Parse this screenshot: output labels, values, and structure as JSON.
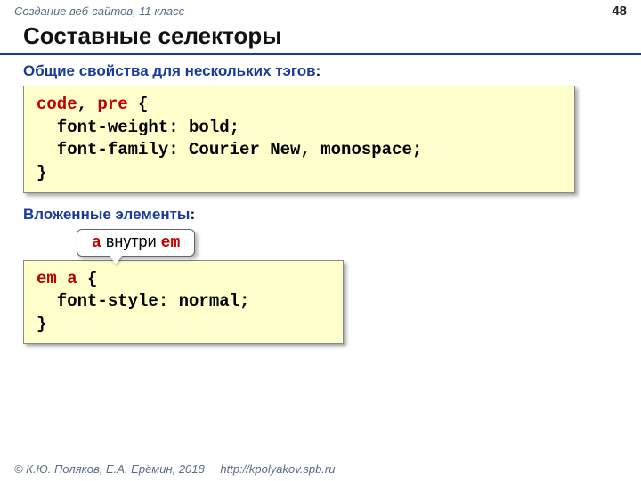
{
  "header": {
    "course": "Создание веб-сайтов, 11 класс",
    "page_number": "48"
  },
  "title": "Составные селекторы",
  "section1": {
    "heading": "Общие свойства для нескольких тэгов",
    "colon": ":",
    "code": {
      "sel1": "code",
      "comma": ", ",
      "sel2": "pre",
      "open": " {",
      "line1": "  font-weight: bold;",
      "line2": "  font-family: Courier New, monospace;",
      "close": "}"
    }
  },
  "section2": {
    "heading": "Вложенные элементы",
    "colon": ":",
    "callout": {
      "a": "a",
      "mid": " внутри ",
      "em": "em"
    },
    "code": {
      "sel1": "em",
      "sp": " ",
      "sel2": "a",
      "open": " {",
      "line1": "  font-style: normal;",
      "close": "}"
    }
  },
  "footer": {
    "copyright": "© К.Ю. Поляков, Е.А. Ерёмин, 2018",
    "url": "http://kpolyakov.spb.ru"
  }
}
